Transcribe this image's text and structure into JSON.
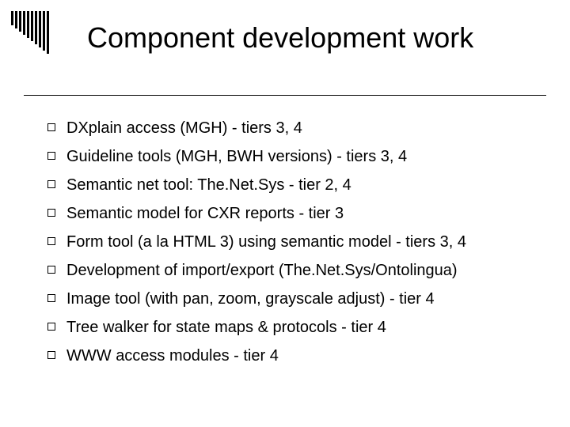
{
  "deco": {
    "bar_heights": [
      18,
      22,
      26,
      30,
      34,
      38,
      42,
      46,
      50,
      54
    ]
  },
  "title": "Component development work",
  "bullets": [
    "DXplain access (MGH) - tiers 3, 4",
    "Guideline tools (MGH, BWH versions) - tiers 3, 4",
    "Semantic net tool:  The.Net.Sys - tier 2, 4",
    "Semantic model for CXR reports - tier 3",
    "Form tool (a la HTML 3) using semantic model - tiers 3, 4",
    "Development of import/export (The.Net.Sys/Ontolingua)",
    "Image tool (with pan, zoom, grayscale adjust) - tier 4",
    "Tree walker for state maps & protocols - tier 4",
    "WWW access modules - tier 4"
  ]
}
